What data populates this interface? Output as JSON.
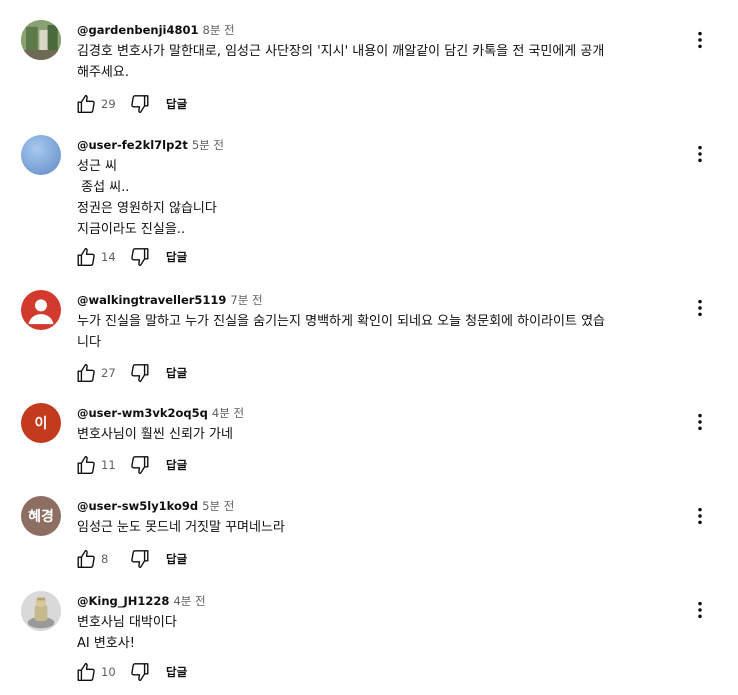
{
  "reply_label": "답글",
  "comments": [
    {
      "author": "@gardenbenji4801",
      "time": "8분 전",
      "lines": [
        "김경호 변호사가 말한대로, 임성근 사단장의 '지시' 내용이 깨알같이 담긴 카톡을 전 국민에게 공개",
        "해주세요."
      ],
      "likes": "29",
      "avatar": {
        "type": "photo-garden",
        "letter": "",
        "color": "#7a8f6a"
      }
    },
    {
      "author": "@user-fe2kl7lp2t",
      "time": "5분 전",
      "lines": [
        "성근 씨",
        " 종섭 씨..",
        "정권은 영원하지 않습니다",
        "지금이라도 진실을.."
      ],
      "likes": "14",
      "avatar": {
        "type": "gradient-blue",
        "letter": "",
        "color": "#7fa7d9"
      }
    },
    {
      "author": "@walkingtraveller5119",
      "time": "7분 전",
      "lines": [
        "누가 진실을 말하고 누가 진실을 숨기는지 명백하게 확인이 되네요 오늘 청문회에 하이라이트 였습",
        "니다"
      ],
      "likes": "27",
      "avatar": {
        "type": "person-red",
        "letter": "",
        "color": "#d13a2c"
      }
    },
    {
      "author": "@user-wm3vk2oq5q",
      "time": "4분 전",
      "lines": [
        "변호사님이 훨씬 신뢰가 가네"
      ],
      "likes": "11",
      "avatar": {
        "type": "letter",
        "letter": "이",
        "color": "#c33a1c"
      }
    },
    {
      "author": "@user-sw5ly1ko9d",
      "time": "5분 전",
      "lines": [
        "임성근 눈도 못드네 거짓말 꾸며네느라"
      ],
      "likes": "8",
      "avatar": {
        "type": "letter",
        "letter": "혜경",
        "color": "#8d6e63"
      }
    },
    {
      "author": "@King_JH1228",
      "time": "4분 전",
      "lines": [
        "변호사님 대박이다",
        "AI 변호사!"
      ],
      "likes": "10",
      "avatar": {
        "type": "photo-figure",
        "letter": "",
        "color": "#c9c9c9"
      }
    }
  ]
}
